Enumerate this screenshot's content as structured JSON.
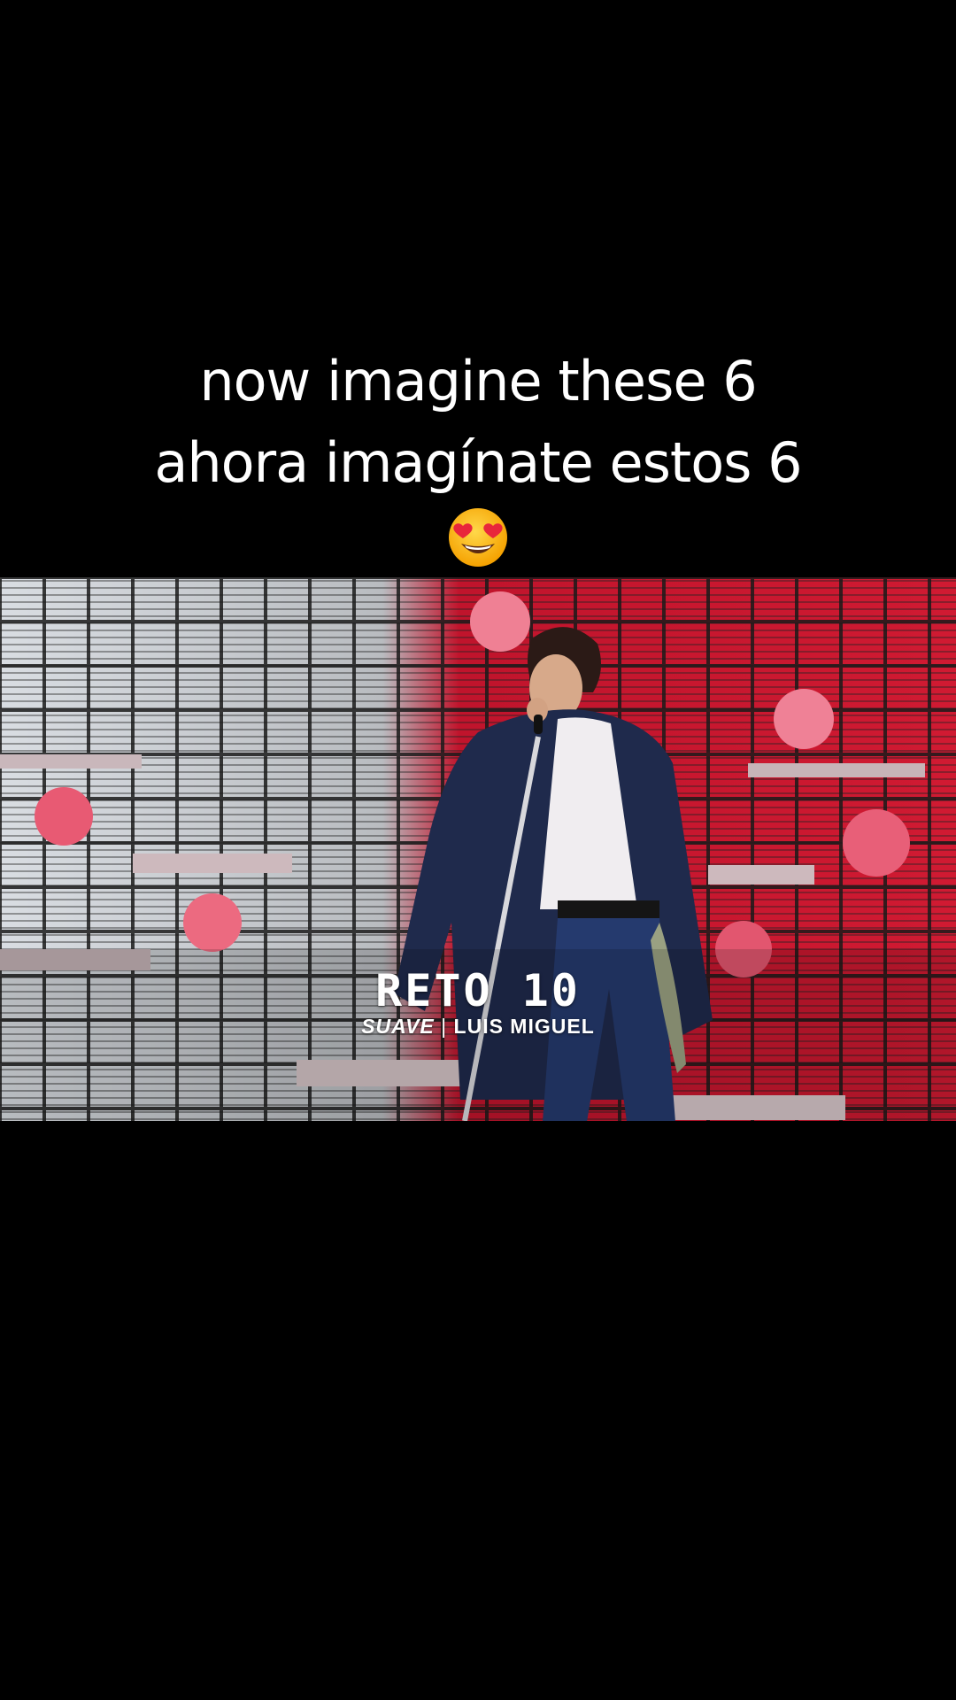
{
  "caption": {
    "line1": "now imagine these 6",
    "line2": "ahora imagínate estos 6",
    "emoji_icon": "smiling-face-with-heart-eyes-icon"
  },
  "video": {
    "title": "RETO 10",
    "song": "SUAVE",
    "separator": "|",
    "artist": "LUIS MIGUEL"
  },
  "colors": {
    "background": "#000000",
    "stage_red": "#c8142a",
    "text": "#ffffff"
  }
}
